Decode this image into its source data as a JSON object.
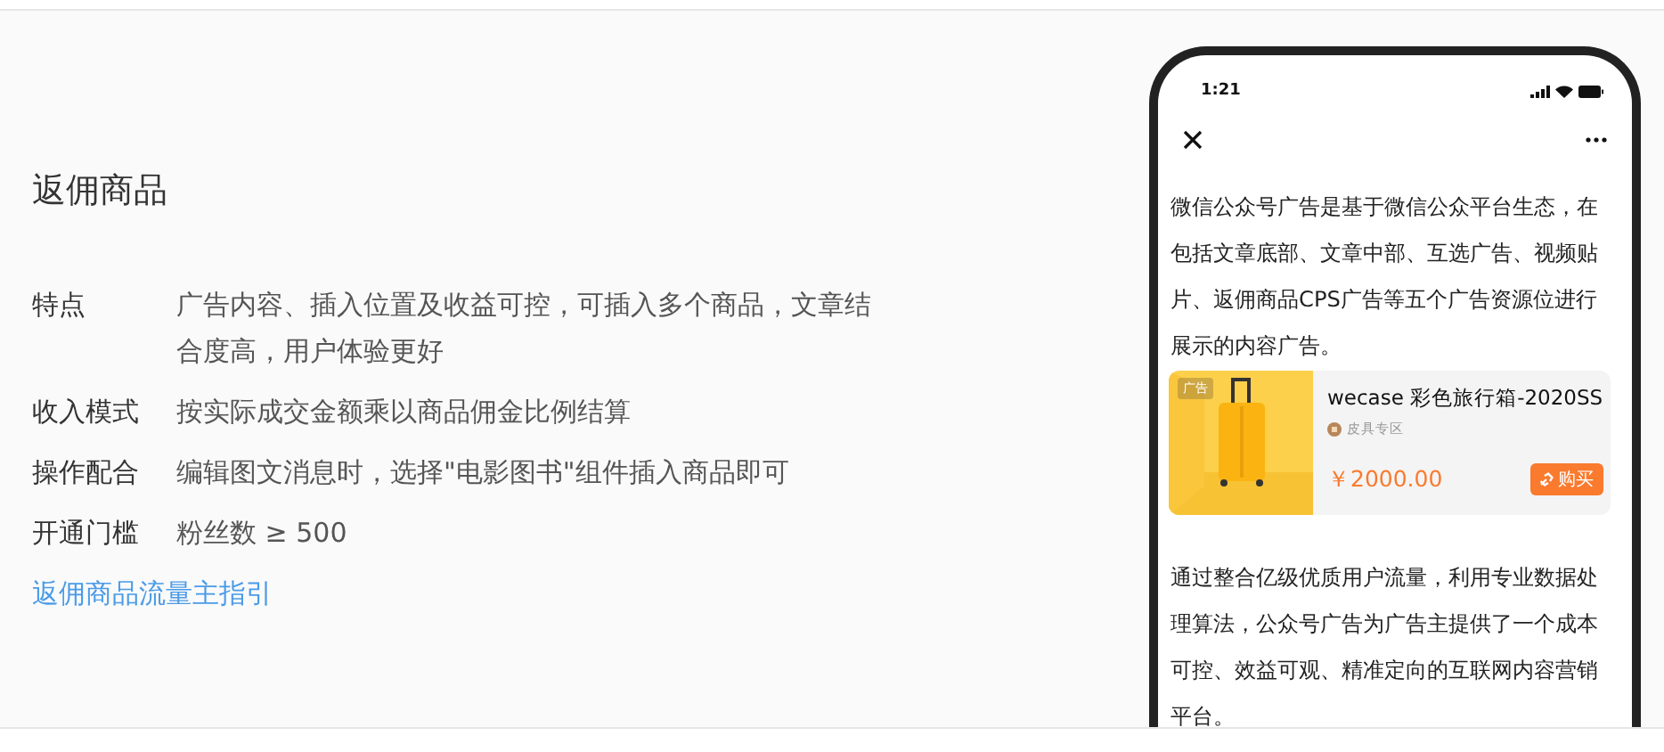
{
  "section": {
    "title": "返佣商品",
    "details": [
      {
        "label": "特点",
        "value": "广告内容、插入位置及收益可控，可插入多个商品，文章结合度高，用户体验更好"
      },
      {
        "label": "收入模式",
        "value": "按实际成交金额乘以商品佣金比例结算"
      },
      {
        "label": "操作配合",
        "value": "编辑图文消息时，选择\"电影图书\"组件插入商品即可"
      },
      {
        "label": "开通门槛",
        "value": "粉丝数 ≥ 500"
      }
    ],
    "link": "返佣商品流量主指引"
  },
  "phone": {
    "time": "1:21",
    "paragraphs": [
      "微信公众号广告是基于微信公众平台生态，在包括文章底部、文章中部、互选广告、视频贴片、返佣商品CPS广告等五个广告资源位进行展示的内容广告。",
      "通过整合亿级优质用户流量，利用专业数据处理算法，公众号广告为广告主提供了一个成本可控、效益可观、精准定向的互联网内容营销平台。"
    ],
    "product": {
      "badge": "广告",
      "title": "wecase 彩色旅行箱-2020SS",
      "shop": "皮具专区",
      "price": "￥2000.00",
      "buy": "购买"
    }
  }
}
